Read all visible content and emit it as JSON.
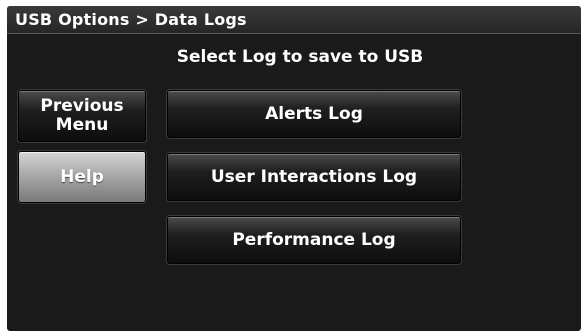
{
  "header": {
    "breadcrumb": "USB Options > Data Logs"
  },
  "main": {
    "prompt": "Select Log to save to USB"
  },
  "nav": {
    "previous_menu_line1": "Previous",
    "previous_menu_line2": "Menu",
    "help": "Help"
  },
  "logs": {
    "alerts": "Alerts Log",
    "user_interactions": "User Interactions Log",
    "performance": "Performance Log"
  },
  "colors": {
    "screen_background": "#1a1a1a",
    "text": "#ffffff",
    "highlighted_button": "#a9a9a9"
  }
}
